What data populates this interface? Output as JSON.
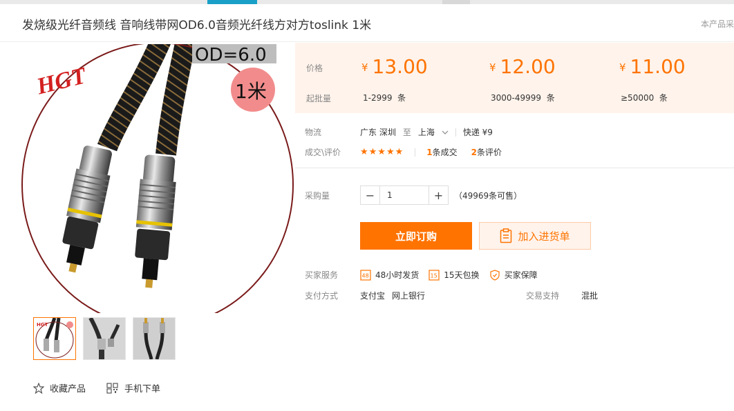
{
  "product": {
    "title": "发烧级光纤音频线 音响线带网OD6.0音频光纤线方对方toslink 1米",
    "notice": "本产品采"
  },
  "image": {
    "logo_text": "HGT",
    "od_label": "OD=6.0",
    "length_label": "1米"
  },
  "gallery": {
    "favorite_label": "收藏产品",
    "mobile_order_label": "手机下单"
  },
  "price": {
    "price_label": "价格",
    "moq_label": "起批量",
    "currency": "¥",
    "tiers": [
      {
        "price": "13.00",
        "range": "1-2999",
        "unit": "条"
      },
      {
        "price": "12.00",
        "range": "3000-49999",
        "unit": "条"
      },
      {
        "price": "11.00",
        "range": "≥50000",
        "unit": "条"
      }
    ]
  },
  "logistics": {
    "label": "物流",
    "from": "广东 深圳",
    "to_word": "至",
    "to": "上海",
    "express": "快递 ¥9"
  },
  "reviews": {
    "label": "成交\\评价",
    "stars": "★★★★★",
    "deals_count": "1",
    "deals_text": "条成交",
    "review_count": "2",
    "review_text": "条评价"
  },
  "purchase": {
    "label": "采购量",
    "quantity": "1",
    "stock_text": "（49969条可售）",
    "buy_label": "立即订购",
    "cart_label": "加入进货单"
  },
  "services": {
    "label": "买家服务",
    "items": [
      "48小时发货",
      "15天包换",
      "买家保障"
    ],
    "icon_texts": [
      "48",
      "15"
    ]
  },
  "payment": {
    "label": "支付方式",
    "methods": [
      "支付宝",
      "网上银行"
    ],
    "trade_label": "交易支持",
    "trade_value": "混批"
  },
  "colors": {
    "accent": "#ff7300",
    "price_bg": "#fff3eb",
    "ring": "#7a1a1a"
  }
}
